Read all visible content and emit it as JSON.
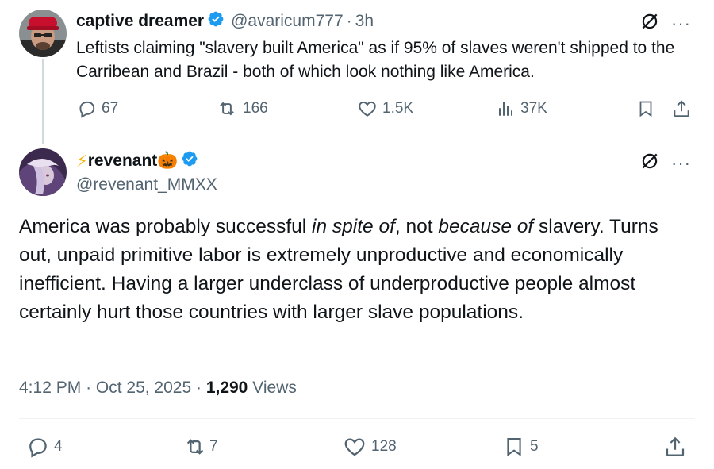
{
  "parent_tweet": {
    "display_name": "captive dreamer",
    "handle": "@avaricum777",
    "time": "3h",
    "text": "Leftists claiming \"slavery built America\" as if 95% of slaves weren't shipped to the Carribean and Brazil - both of which look nothing like America.",
    "replies": "67",
    "reposts": "166",
    "likes": "1.5K",
    "views": "37K"
  },
  "main_tweet": {
    "display_name": "revenant",
    "name_emoji_prefix": "⚡",
    "name_emoji_suffix": "🎃",
    "handle": "@revenant_MMXX",
    "text_part1": "America was probably successful ",
    "text_em1": "in spite of",
    "text_part2": ", not ",
    "text_em2": "because of",
    "text_part3": " slavery. Turns out, unpaid primitive labor is extremely unproductive and economically inefficient. Having a larger underclass of underproductive people almost certainly hurt those countries with larger slave populations.",
    "time": "4:12 PM",
    "date": "Oct 25, 2025",
    "views_count": "1,290",
    "views_label": "Views",
    "replies": "4",
    "reposts": "7",
    "likes": "128",
    "bookmarks": "5"
  },
  "colors": {
    "text": "#0f1419",
    "secondary": "#536471",
    "verified": "#1d9bf0",
    "divider": "#eff3f4"
  }
}
